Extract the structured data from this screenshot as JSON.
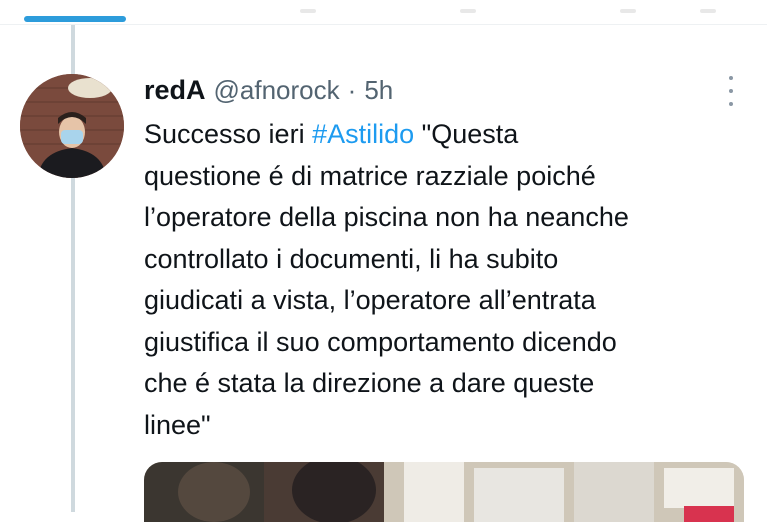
{
  "colors": {
    "accent": "#2d9cdb",
    "hashtag": "#1d9bf0",
    "text_primary": "#0f1419",
    "text_secondary": "#536471",
    "thread_line": "#cfd9de"
  },
  "tweet": {
    "author_name": "redA",
    "handle": "@afnorock",
    "separator": "·",
    "timestamp": "5h",
    "more_icon": "more-vertical-icon",
    "text": {
      "line1_prefix": "Successo ieri ",
      "hashtag": "#Astilido",
      "line1_suffix": " \"Questa",
      "line2": "questione é di matrice razziale poiché",
      "line3": "l’operatore della piscina non ha neanche",
      "line4": "controllato i documenti, li ha subito",
      "line5": "giudicati a vista, l’operatore all’entrata",
      "line6": "giustifica il suo comportamento dicendo",
      "line7": "che é stata la direzione a  dare queste",
      "line8": "linee\""
    }
  }
}
